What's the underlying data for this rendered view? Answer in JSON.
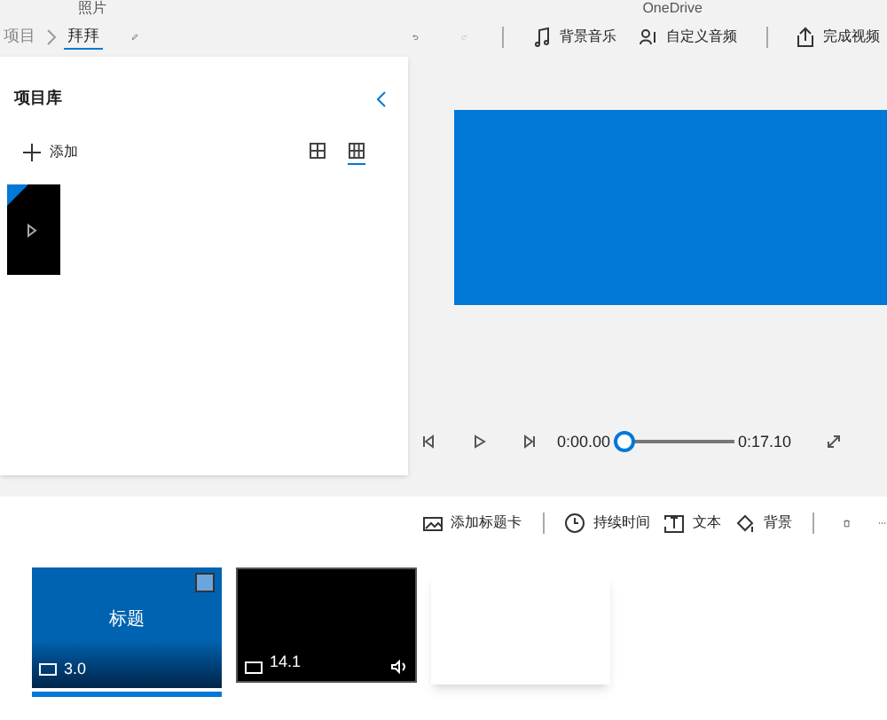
{
  "window": {
    "title": "照片",
    "account": "OneDrive"
  },
  "breadcrumb": [
    {
      "label": "项目",
      "selected": false
    },
    {
      "label": "拜拜",
      "selected": true
    }
  ],
  "toolbar": [
    "背景音乐",
    "自定义音频",
    "完成视频"
  ],
  "library": {
    "title": "项目库",
    "add": "添加",
    "views": [
      {
        "kind": "grid",
        "selected": false
      },
      {
        "kind": "list",
        "selected": true
      }
    ],
    "items": [
      {
        "kind": "video"
      }
    ]
  },
  "player": {
    "current": "0:00.00",
    "total": "0:17.10",
    "level": 0
  },
  "storyboard_toolbar": [
    "添加标题卡",
    "持续时间",
    "文本",
    "背景"
  ],
  "cards": [
    {
      "kind": "title",
      "title": "标题",
      "duration": "3.0",
      "checked": false,
      "selected": true
    },
    {
      "kind": "video",
      "duration": "14.1",
      "selected": false
    },
    {
      "kind": "empty",
      "selected": false
    }
  ]
}
